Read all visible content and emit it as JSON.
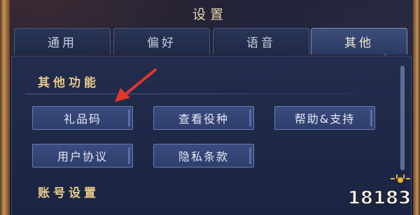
{
  "window": {
    "title": "设置"
  },
  "tabs": [
    {
      "label": "通用",
      "active": false
    },
    {
      "label": "偏好",
      "active": false
    },
    {
      "label": "语音",
      "active": false
    },
    {
      "label": "其他",
      "active": true
    }
  ],
  "sections": {
    "other_functions": {
      "title": "其他功能",
      "buttons": {
        "gift_code": "礼品码",
        "view_role": "查看役种",
        "help_support": "帮助&支持",
        "user_agreement": "用户协议",
        "privacy_terms": "隐私条款"
      }
    },
    "account_settings": {
      "title": "账号设置"
    }
  },
  "watermark": {
    "text": "18183"
  },
  "colors": {
    "accent_gold": "#e8c98a",
    "button_fill": "#34457a",
    "arrow_red": "#e0362c",
    "tab_active": "#3d4d7a"
  },
  "icons": {
    "annotation": "red-arrow-icon",
    "watermark": "18183-logo-icon"
  }
}
